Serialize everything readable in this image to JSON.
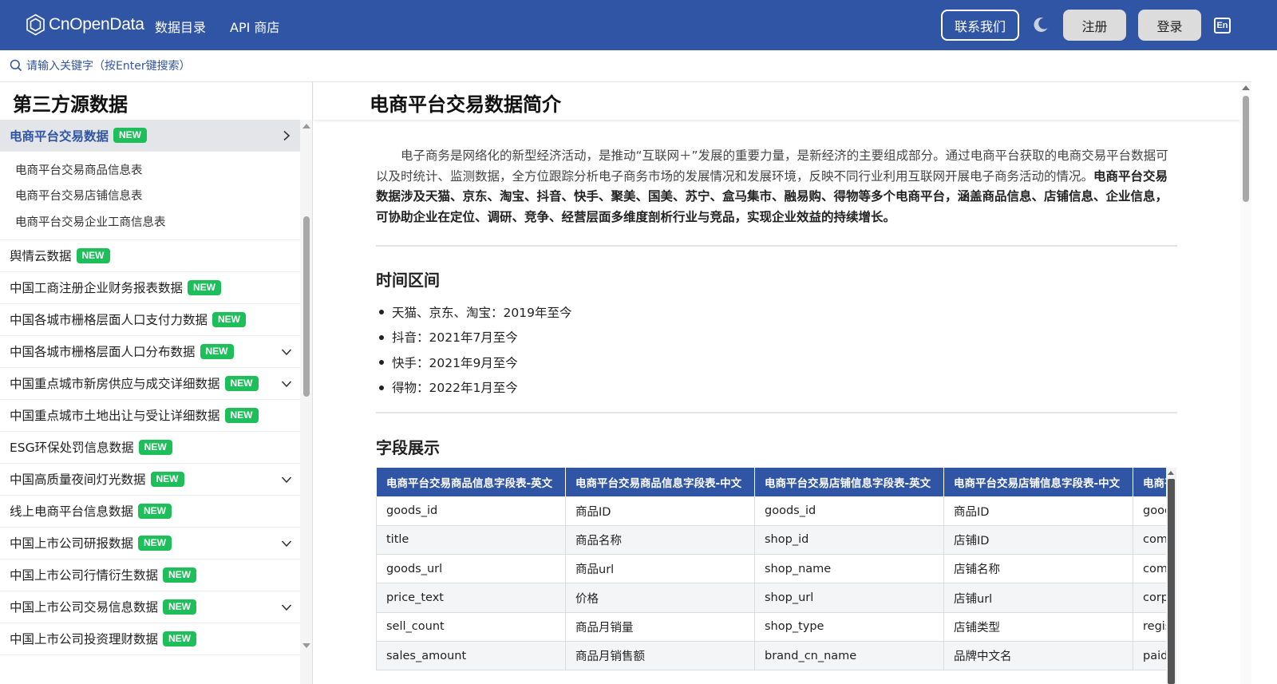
{
  "header": {
    "logo_text": "CnOpenData",
    "nav": [
      "数据目录",
      "API 商店"
    ],
    "contact_label": "联系我们",
    "register_label": "注册",
    "login_label": "登录",
    "lang_label": "En",
    "colors": {
      "bar": "#2f55a4",
      "badge": "#1ebf5a"
    }
  },
  "search": {
    "placeholder": "请输入关键字（按Enter键搜索）"
  },
  "sidebar": {
    "title": "第三方源数据",
    "active_item": {
      "label": "电商平台交易数据",
      "badge": "NEW",
      "icon": "chevron-right-icon"
    },
    "sub_items": [
      "电商平台交易商品信息表",
      "电商平台交易店铺信息表",
      "电商平台交易企业工商信息表"
    ],
    "items": [
      {
        "label": "舆情云数据",
        "badge": "NEW",
        "expandable": false
      },
      {
        "label": "中国工商注册企业财务报表数据",
        "badge": "NEW",
        "expandable": false
      },
      {
        "label": "中国各城市栅格层面人口支付力数据",
        "badge": "NEW",
        "expandable": false
      },
      {
        "label": "中国各城市栅格层面人口分布数据",
        "badge": "NEW",
        "expandable": true
      },
      {
        "label": "中国重点城市新房供应与成交详细数据",
        "badge": "NEW",
        "expandable": true
      },
      {
        "label": "中国重点城市土地出让与受让详细数据",
        "badge": "NEW",
        "expandable": false
      },
      {
        "label": "ESG环保处罚信息数据",
        "badge": "NEW",
        "expandable": false
      },
      {
        "label": "中国高质量夜间灯光数据",
        "badge": "NEW",
        "expandable": true
      },
      {
        "label": "线上电商平台信息数据",
        "badge": "NEW",
        "expandable": false
      },
      {
        "label": "中国上市公司研报数据",
        "badge": "NEW",
        "expandable": true
      },
      {
        "label": "中国上市公司行情衍生数据",
        "badge": "NEW",
        "expandable": false
      },
      {
        "label": "中国上市公司交易信息数据",
        "badge": "NEW",
        "expandable": true
      },
      {
        "label": "中国上市公司投资理财数据",
        "badge": "NEW",
        "expandable": false
      }
    ]
  },
  "main": {
    "title": "电商平台交易数据简介",
    "intro_plain": "电子商务是网络化的新型经济活动，是推动“互联网＋”发展的重要力量，是新经济的主要组成部分。通过电商平台获取的电商交易平台数据可以及时统计、监测数据，全方位跟踪分析电子商务市场的发展情况和发展环境，反映不同行业利用互联网开展电子商务活动的情况。",
    "intro_bold": "电商平台交易数据涉及天猫、京东、淘宝、抖音、快手、聚美、国美、苏宁、盒马集市、融易购、得物等多个电商平台，涵盖商品信息、店铺信息、企业信息，可协助企业在定位、调研、竞争、经营层面多维度剖析行业与竞品，实现企业效益的持续增长。",
    "time_section_title": "时间区间",
    "time_items": [
      "天猫、京东、淘宝：2019年至今",
      "抖音：2021年7月至今",
      "快手：2021年9月至今",
      "得物：2022年1月至今"
    ],
    "fields_section_title": "字段展示",
    "table": {
      "headers": [
        "电商平台交易商品信息字段表-英文",
        "电商平台交易商品信息字段表-中文",
        "电商平台交易店铺信息字段表-英文",
        "电商平台交易店铺信息字段表-中文",
        "电商平台交易企业工商信息字段表-英文"
      ],
      "rows": [
        [
          "goods_id",
          "商品ID",
          "goods_id",
          "商品ID",
          "goods_id"
        ],
        [
          "title",
          "商品名称",
          "shop_id",
          "店铺ID",
          "company_name"
        ],
        [
          "goods_url",
          "商品url",
          "shop_name",
          "店铺名称",
          "company_id"
        ],
        [
          "price_text",
          "价格",
          "shop_url",
          "店铺url",
          "corp_code"
        ],
        [
          "sell_count",
          "商品月销量",
          "shop_type",
          "店铺类型",
          "regis_capital"
        ],
        [
          "sales_amount",
          "商品月销售额",
          "brand_cn_name",
          "品牌中文名",
          "paid_capital"
        ]
      ]
    }
  }
}
